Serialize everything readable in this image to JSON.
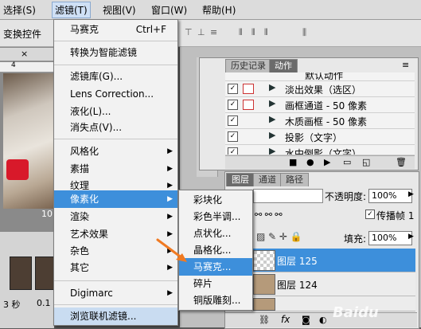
{
  "menubar": {
    "items": [
      "选择(S)",
      "滤镜(T)",
      "视图(V)",
      "窗口(W)",
      "帮助(H)"
    ]
  },
  "optionsbar": {
    "label": "变换控件"
  },
  "document": {
    "tab_close": "×",
    "ruler_tick": "4",
    "zoom_fragment": "10"
  },
  "animation": {
    "frame_time": "3 秒",
    "frame_time2": "0.1"
  },
  "filter_menu": {
    "items": [
      {
        "label": "马赛克",
        "shortcut": "Ctrl+F"
      },
      {
        "label": "转换为智能滤镜"
      },
      {
        "label": "滤镜库(G)..."
      },
      {
        "label": "Lens Correction..."
      },
      {
        "label": "液化(L)..."
      },
      {
        "label": "消失点(V)..."
      },
      {
        "label": "风格化"
      },
      {
        "label": "素描"
      },
      {
        "label": "纹理"
      },
      {
        "label": "像素化"
      },
      {
        "label": "渲染"
      },
      {
        "label": "艺术效果"
      },
      {
        "label": "杂色"
      },
      {
        "label": "其它"
      },
      {
        "label": "Digimarc"
      },
      {
        "label": "浏览联机滤镜..."
      }
    ]
  },
  "pixelate_submenu": {
    "items": [
      "彩块化",
      "彩色半调...",
      "点状化...",
      "晶格化...",
      "马赛克...",
      "碎片",
      "铜版雕刻..."
    ]
  },
  "history_panel": {
    "tabs": [
      "历史记录",
      "动作"
    ],
    "header_fragment": "默认动作",
    "actions": [
      "淡出效果（选区）",
      "画框通道 - 50 像素",
      "木质画框 - 50 像素",
      "投影（文字）",
      "水中倒影（文字）"
    ]
  },
  "layers_panel": {
    "tabs": [
      "图层",
      "通道",
      "路径"
    ],
    "opacity_label": "不透明度:",
    "opacity_value": "100%",
    "propagate_label": "传播帧 1",
    "fill_label": "填充:",
    "fill_value": "100%",
    "layers": [
      "图层 125",
      "图层 124"
    ]
  },
  "watermark": "Baidu",
  "colors": {
    "menu_highlight": "#3d8fdb",
    "layer_selected": "#3d8fdb",
    "annotation_arrow": "#f07a22",
    "menubar_bg": "#dcdcdc"
  }
}
